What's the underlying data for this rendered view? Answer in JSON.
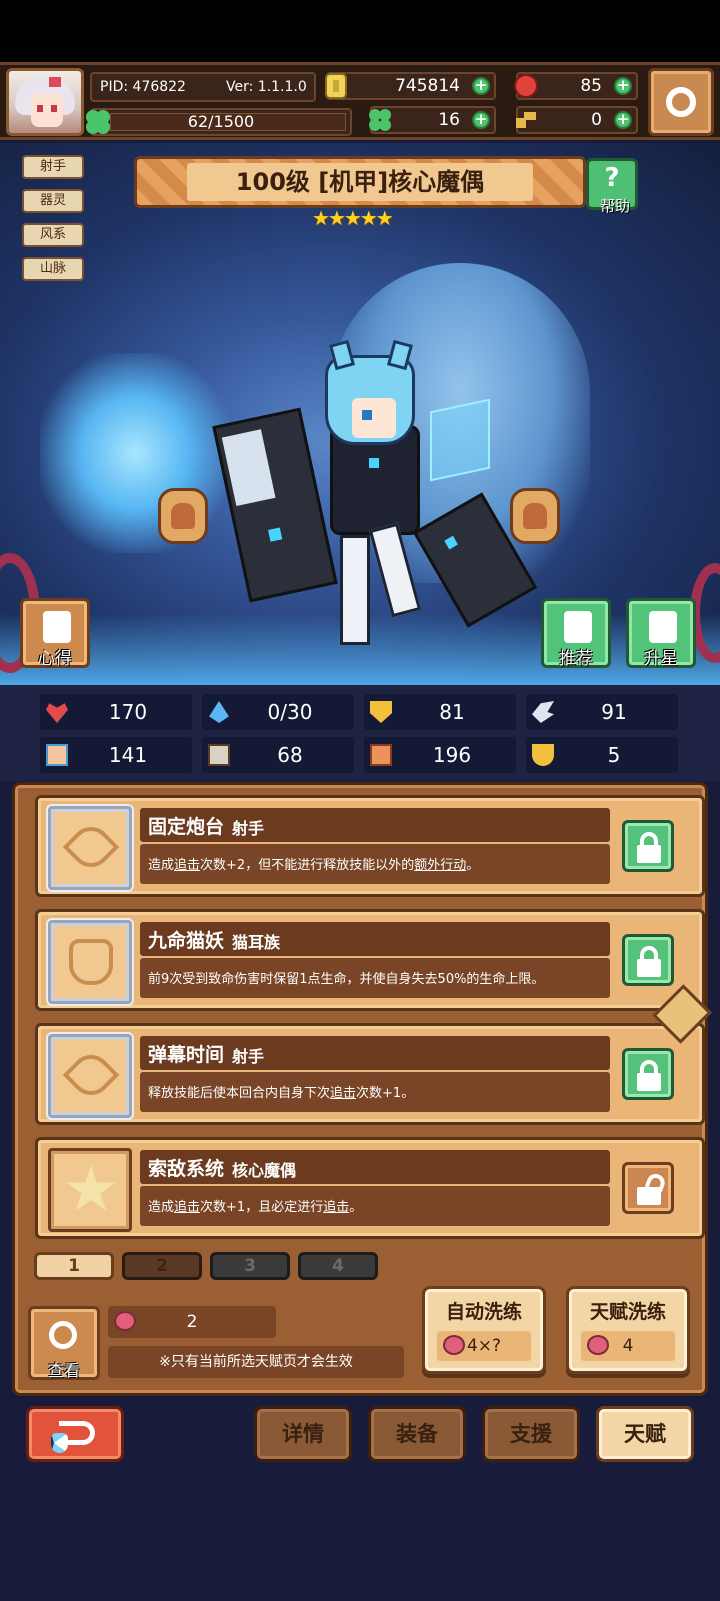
{
  "player": {
    "pid": "PID: 476822",
    "version": "Ver: 1.1.1.0",
    "exp": "62/1500"
  },
  "resources": {
    "gold": "745814",
    "ruby": "85",
    "clover": "16",
    "key": "0"
  },
  "hero": {
    "tags": [
      "射手",
      "器灵",
      "风系",
      "山脉"
    ],
    "title": "100级 [机甲]核心魔偶",
    "stars": 5,
    "help_label": "帮助",
    "xinde_label": "心得",
    "recommend_label": "推荐",
    "upstar_label": "升星"
  },
  "stats": {
    "hp": "170",
    "mana": "0/30",
    "defense": "81",
    "speed": "91",
    "attack": "141",
    "magic": "68",
    "agility": "196",
    "luck": "5"
  },
  "talents": [
    {
      "name": "固定炮台",
      "tag": "射手",
      "desc_parts": [
        "造成",
        "追击",
        "次数+2，但不能进行释放技能以外的",
        "额外行动",
        "。"
      ],
      "locked": true
    },
    {
      "name": "九命猫妖",
      "tag": "猫耳族",
      "desc_parts": [
        "前9次受到致命伤害时保留1点生命，并使自身失去50%的生命上限。"
      ],
      "locked": true
    },
    {
      "name": "弹幕时间",
      "tag": "射手",
      "desc_parts": [
        "释放技能后使本回合内自身下次",
        "追击",
        "次数+1。"
      ],
      "locked": true
    },
    {
      "name": "索敌系统",
      "tag": "核心魔偶",
      "desc_parts": [
        "造成",
        "追击",
        "次数+1，且必定进行",
        "追击",
        "。"
      ],
      "locked": false
    }
  ],
  "pages": [
    "1",
    "2",
    "3",
    "4"
  ],
  "bottom": {
    "view_label": "查看",
    "fruit_count": "2",
    "notice": "※只有当前所选天赋页才会生效",
    "auto_wash_label": "自动洗练",
    "auto_wash_cost": "4×?",
    "talent_wash_label": "天赋洗练",
    "talent_wash_cost": "4"
  },
  "nav": {
    "details": "详情",
    "equipment": "装备",
    "support": "支援",
    "talent": "天赋"
  },
  "colors": {
    "gold_icon": "#f1d55a",
    "ruby_icon": "#e0433b",
    "clover_icon": "#4bc46a",
    "key_icon": "#e6b84a",
    "locked_green": "#54c27a",
    "unlocked_brown": "#cc8650"
  }
}
